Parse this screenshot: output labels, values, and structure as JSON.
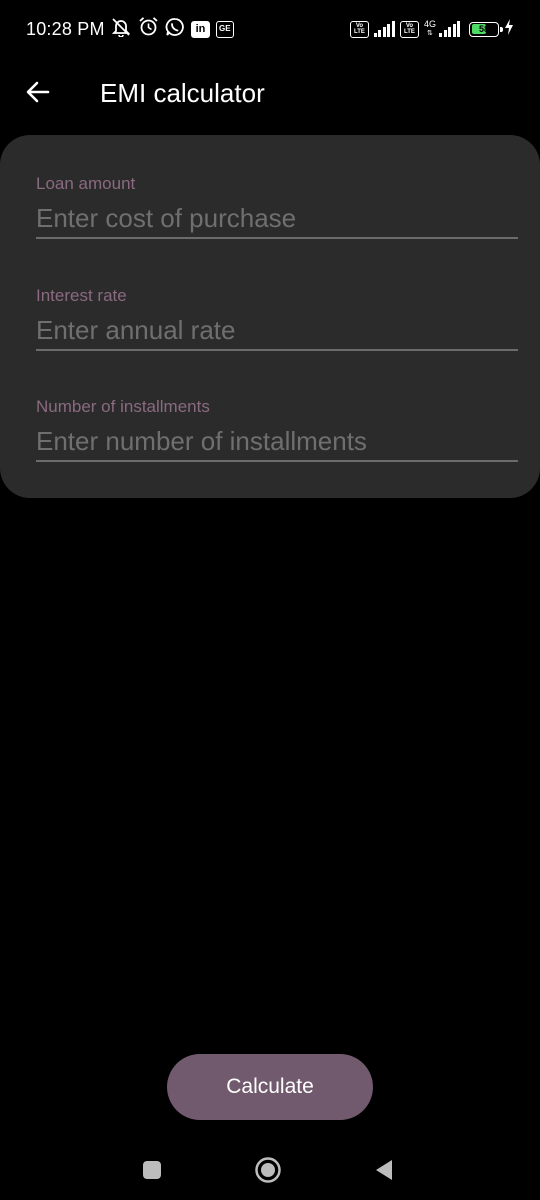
{
  "status_bar": {
    "time": "10:28 PM",
    "left_icons": [
      "muted-notification-icon",
      "alarm-icon",
      "whatsapp-icon",
      "linkedin-icon",
      "ge-icon"
    ],
    "ge_label": "GE",
    "linkedin_label": "in",
    "volte_label_top": "Vo",
    "volte_label_bottom": "LTE",
    "network_type": "4G",
    "battery_level": "58",
    "battery_fraction": 0.58,
    "battery_color": "#4cd964"
  },
  "app_bar": {
    "back_icon": "arrow-back-icon",
    "title": "EMI calculator"
  },
  "form": {
    "loan_amount": {
      "label": "Loan amount",
      "placeholder": "Enter cost of purchase",
      "value": ""
    },
    "interest_rate": {
      "label": "Interest rate",
      "placeholder": "Enter annual rate",
      "value": ""
    },
    "installments": {
      "label": "Number of installments",
      "placeholder": "Enter number of installments",
      "value": ""
    }
  },
  "actions": {
    "calculate_label": "Calculate",
    "button_color": "#715a6d"
  },
  "nav_bar": {
    "items": [
      "recents-square-icon",
      "home-circle-icon",
      "back-triangle-icon"
    ]
  },
  "colors": {
    "background": "#000000",
    "card": "#2b2b2b",
    "label_accent": "#8a6a80"
  }
}
